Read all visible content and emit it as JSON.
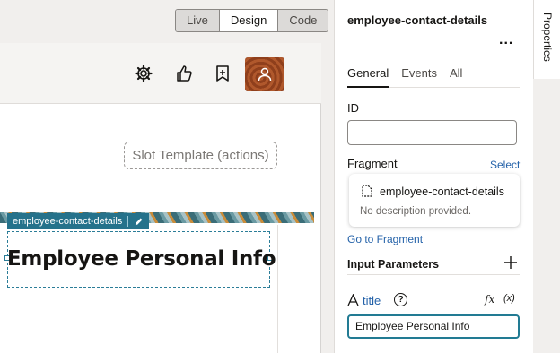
{
  "toolbar": {
    "modes": [
      "Live",
      "Design",
      "Code"
    ],
    "active_mode": "Design"
  },
  "header_icons": [
    "gear-icon",
    "thumbs-up-icon",
    "bookmark-icon",
    "user-avatar"
  ],
  "canvas": {
    "slot_label": "Slot Template (actions)",
    "fragment_tag": "employee-contact-details",
    "fragment_heading": "Employee Personal Info"
  },
  "properties": {
    "title": "employee-contact-details",
    "more": "...",
    "tabs": [
      "General",
      "Events",
      "All"
    ],
    "active_tab": "General",
    "id_label": "ID",
    "id_value": "",
    "fragment_label": "Fragment",
    "select_link": "Select",
    "fragment_card": {
      "name": "employee-contact-details",
      "description": "No description provided."
    },
    "goto_link": "Go to Fragment",
    "input_params_label": "Input Parameters",
    "param": {
      "name": "title",
      "help": "?",
      "fx": "fx",
      "var": "(x)",
      "value": "Employee Personal Info"
    }
  },
  "side_tab": "Properties",
  "colors": {
    "accent": "#227b93",
    "link": "#2462a9",
    "fragment_tag": "#25728b"
  }
}
